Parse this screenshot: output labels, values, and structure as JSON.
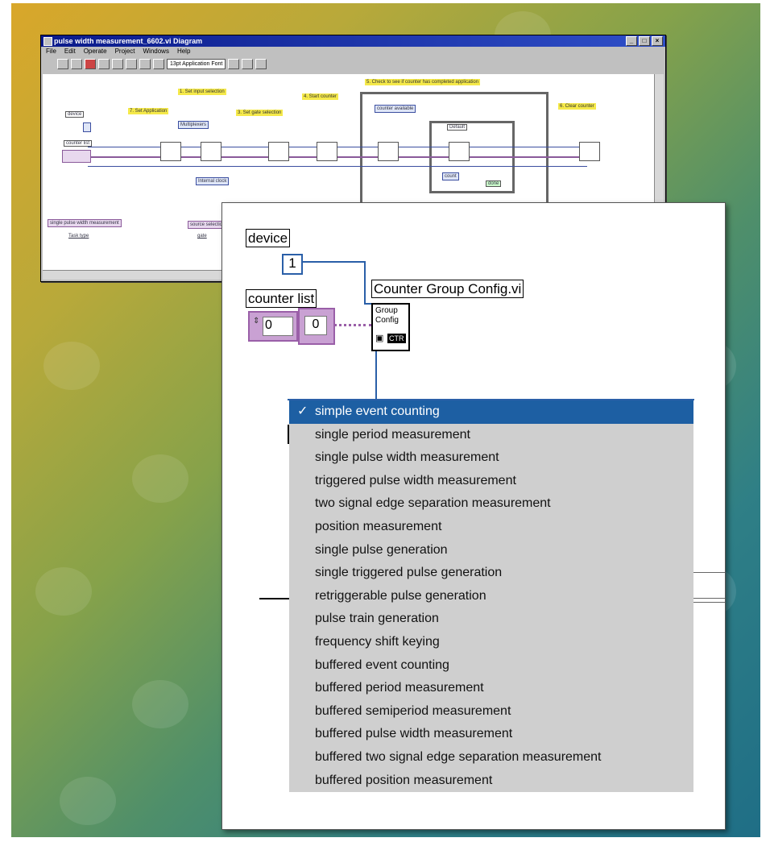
{
  "small_window": {
    "title": "pulse width measurement_6602.vi Diagram",
    "title_buttons": [
      "_",
      "□",
      "×"
    ],
    "menu": [
      "File",
      "Edit",
      "Operate",
      "Project",
      "Windows",
      "Help"
    ],
    "font_select": "13pt Application Font",
    "notes": [
      "1. Set input selection",
      "7. Set Application",
      "3. Set gate selection",
      "4. Start counter",
      "5. Check to see if counter has completed application",
      "6. Clear counter"
    ],
    "labels": [
      "device",
      "counter list",
      "Multiplexers",
      "Internal clock",
      "counter available",
      "Default",
      "count",
      "done",
      "single pulse width measurement",
      "Task type",
      "source selection",
      "gate"
    ]
  },
  "zoom": {
    "device_label": "device",
    "device_value": "1",
    "counter_list_label": "counter list",
    "counter_index": "0",
    "counter_value": "0",
    "vi_label": "Counter Group Config.vi",
    "vi_icon_line1": "Group",
    "vi_icon_line2": "Config",
    "vi_icon_badge": "CTR",
    "selected_check": "✓",
    "menu_items": [
      "simple event counting",
      "single period measurement",
      "single pulse width measurement",
      "triggered pulse width measurement",
      "two signal edge separation measurement",
      "position measurement",
      "single pulse generation",
      "single triggered pulse generation",
      "retriggerable pulse generation",
      "pulse train generation",
      "frequency shift keying",
      "buffered event counting",
      "buffered period measurement",
      "buffered semiperiod measurement",
      "buffered pulse width measurement",
      "buffered two signal edge separation measurement",
      "buffered position measurement"
    ]
  },
  "colors": {
    "selection": "#1d5fa3",
    "wire_blue": "#2a5fa8",
    "wire_purple": "#9a5fa8",
    "note_yellow": "#f5e94a"
  }
}
